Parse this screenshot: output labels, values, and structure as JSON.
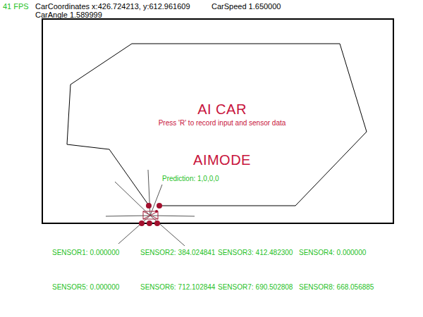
{
  "hud": {
    "fps": "41 FPS",
    "coordinates": "CarCoordinates x:426.724213, y:612.961609",
    "speed": "CarSpeed 1.650000",
    "angle": "CarAngle 1.589999"
  },
  "title": "AI CAR",
  "instruction": "Press 'R' to record input and sensor data",
  "mode": "AIMODE",
  "prediction": "Prediction: 1,0,0,0",
  "sensors": [
    {
      "label": "SENSOR1:",
      "value": "0.000000"
    },
    {
      "label": "SENSOR2:",
      "value": "384.024841"
    },
    {
      "label": "SENSOR3:",
      "value": "412.482300"
    },
    {
      "label": "SENSOR4:",
      "value": "0.000000"
    },
    {
      "label": "SENSOR5:",
      "value": "0.000000"
    },
    {
      "label": "SENSOR6:",
      "value": "712.102844"
    },
    {
      "label": "SENSOR7:",
      "value": "690.502808"
    },
    {
      "label": "SENSOR8:",
      "value": "668.056885"
    }
  ]
}
